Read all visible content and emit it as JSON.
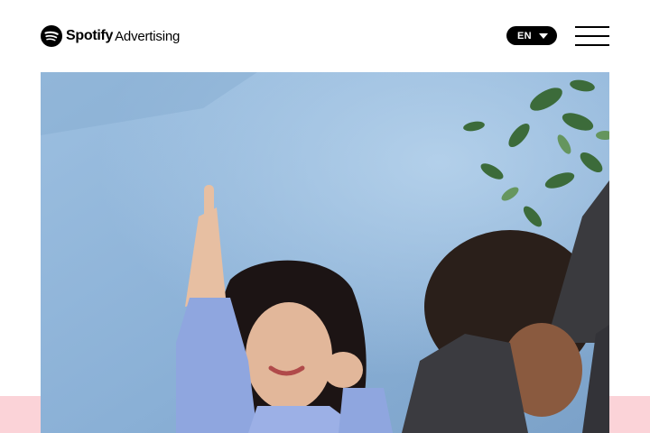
{
  "header": {
    "logo": {
      "wordmark": "Spotify",
      "suffix": "Advertising",
      "icon": "spotify-logo-icon"
    },
    "language": {
      "label": "EN",
      "icon": "caret-down-icon"
    },
    "menu": {
      "icon": "hamburger-menu-icon"
    }
  },
  "hero": {
    "image": "photo of two smiling young women dancing with arms raised against a light blue wall",
    "colors": {
      "wall": "#8ab0d6",
      "band": "#fbd3d8"
    }
  }
}
